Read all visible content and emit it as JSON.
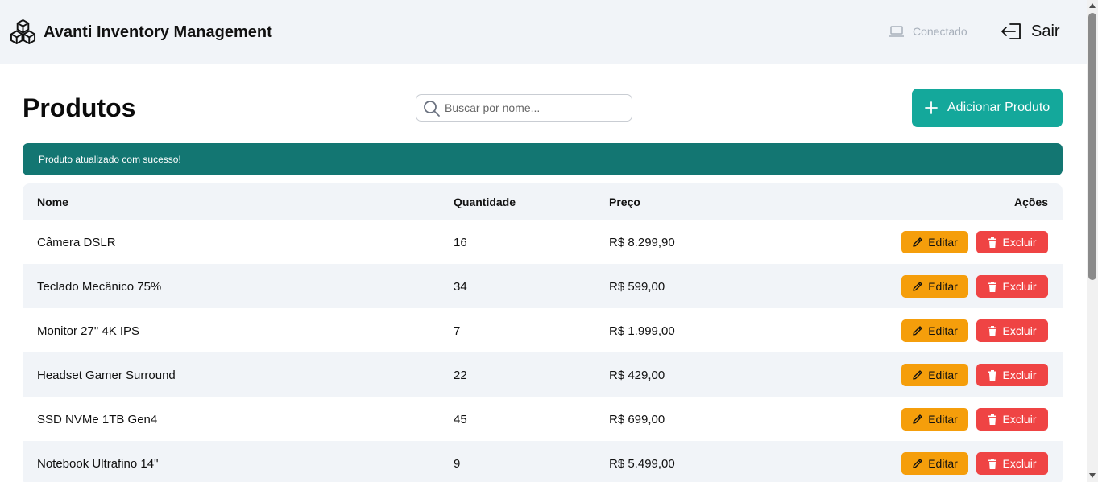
{
  "header": {
    "brand_title": "Avanti Inventory Management",
    "status_label": "Conectado",
    "logout_label": "Sair"
  },
  "page": {
    "title": "Produtos",
    "search_placeholder": "Buscar por nome...",
    "add_button_label": "Adicionar Produto",
    "toast_message": "Produto atualizado com sucesso!"
  },
  "table": {
    "headers": {
      "name": "Nome",
      "quantity": "Quantidade",
      "price": "Preço",
      "actions": "Ações"
    },
    "edit_label": "Editar",
    "delete_label": "Excluir",
    "rows": [
      {
        "name": "Câmera DSLR",
        "quantity": "16",
        "price": "R$ 8.299,90"
      },
      {
        "name": "Teclado Mecânico 75%",
        "quantity": "34",
        "price": "R$ 599,00"
      },
      {
        "name": "Monitor 27\" 4K IPS",
        "quantity": "7",
        "price": "R$ 1.999,00"
      },
      {
        "name": "Headset Gamer Surround",
        "quantity": "22",
        "price": "R$ 429,00"
      },
      {
        "name": "SSD NVMe 1TB Gen4",
        "quantity": "45",
        "price": "R$ 699,00"
      },
      {
        "name": "Notebook Ultrafino 14\"",
        "quantity": "9",
        "price": "R$ 5.499,00"
      }
    ]
  },
  "colors": {
    "accent": "#14a89b",
    "toast": "#137672",
    "edit": "#f59e0b",
    "delete": "#ef4444"
  }
}
